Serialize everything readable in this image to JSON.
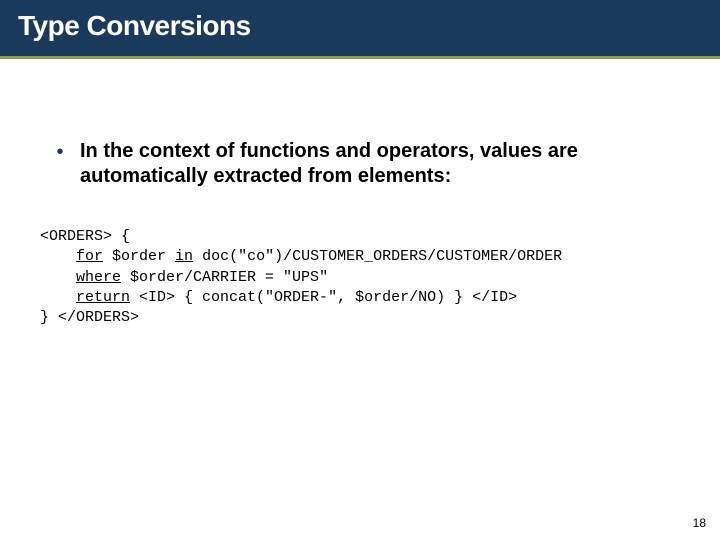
{
  "header": {
    "title": "Type Conversions"
  },
  "bullet": {
    "marker": "•",
    "text": "In the context of functions and operators, values are automatically extracted from elements:"
  },
  "code": {
    "line1_a": "<ORDERS> {",
    "line2_kw": "for",
    "line2_mid": " $order ",
    "line2_kw2": "in",
    "line2_rest": " doc(\"co\")/CUSTOMER_ORDERS/CUSTOMER/ORDER",
    "line3_kw": "where",
    "line3_rest": " $order/CARRIER = \"UPS\"",
    "line4_kw": "return",
    "line4_rest": " <ID> { concat(\"ORDER-\", $order/NO) } </ID>",
    "line5": "} </ORDERS>"
  },
  "page_number": "18"
}
